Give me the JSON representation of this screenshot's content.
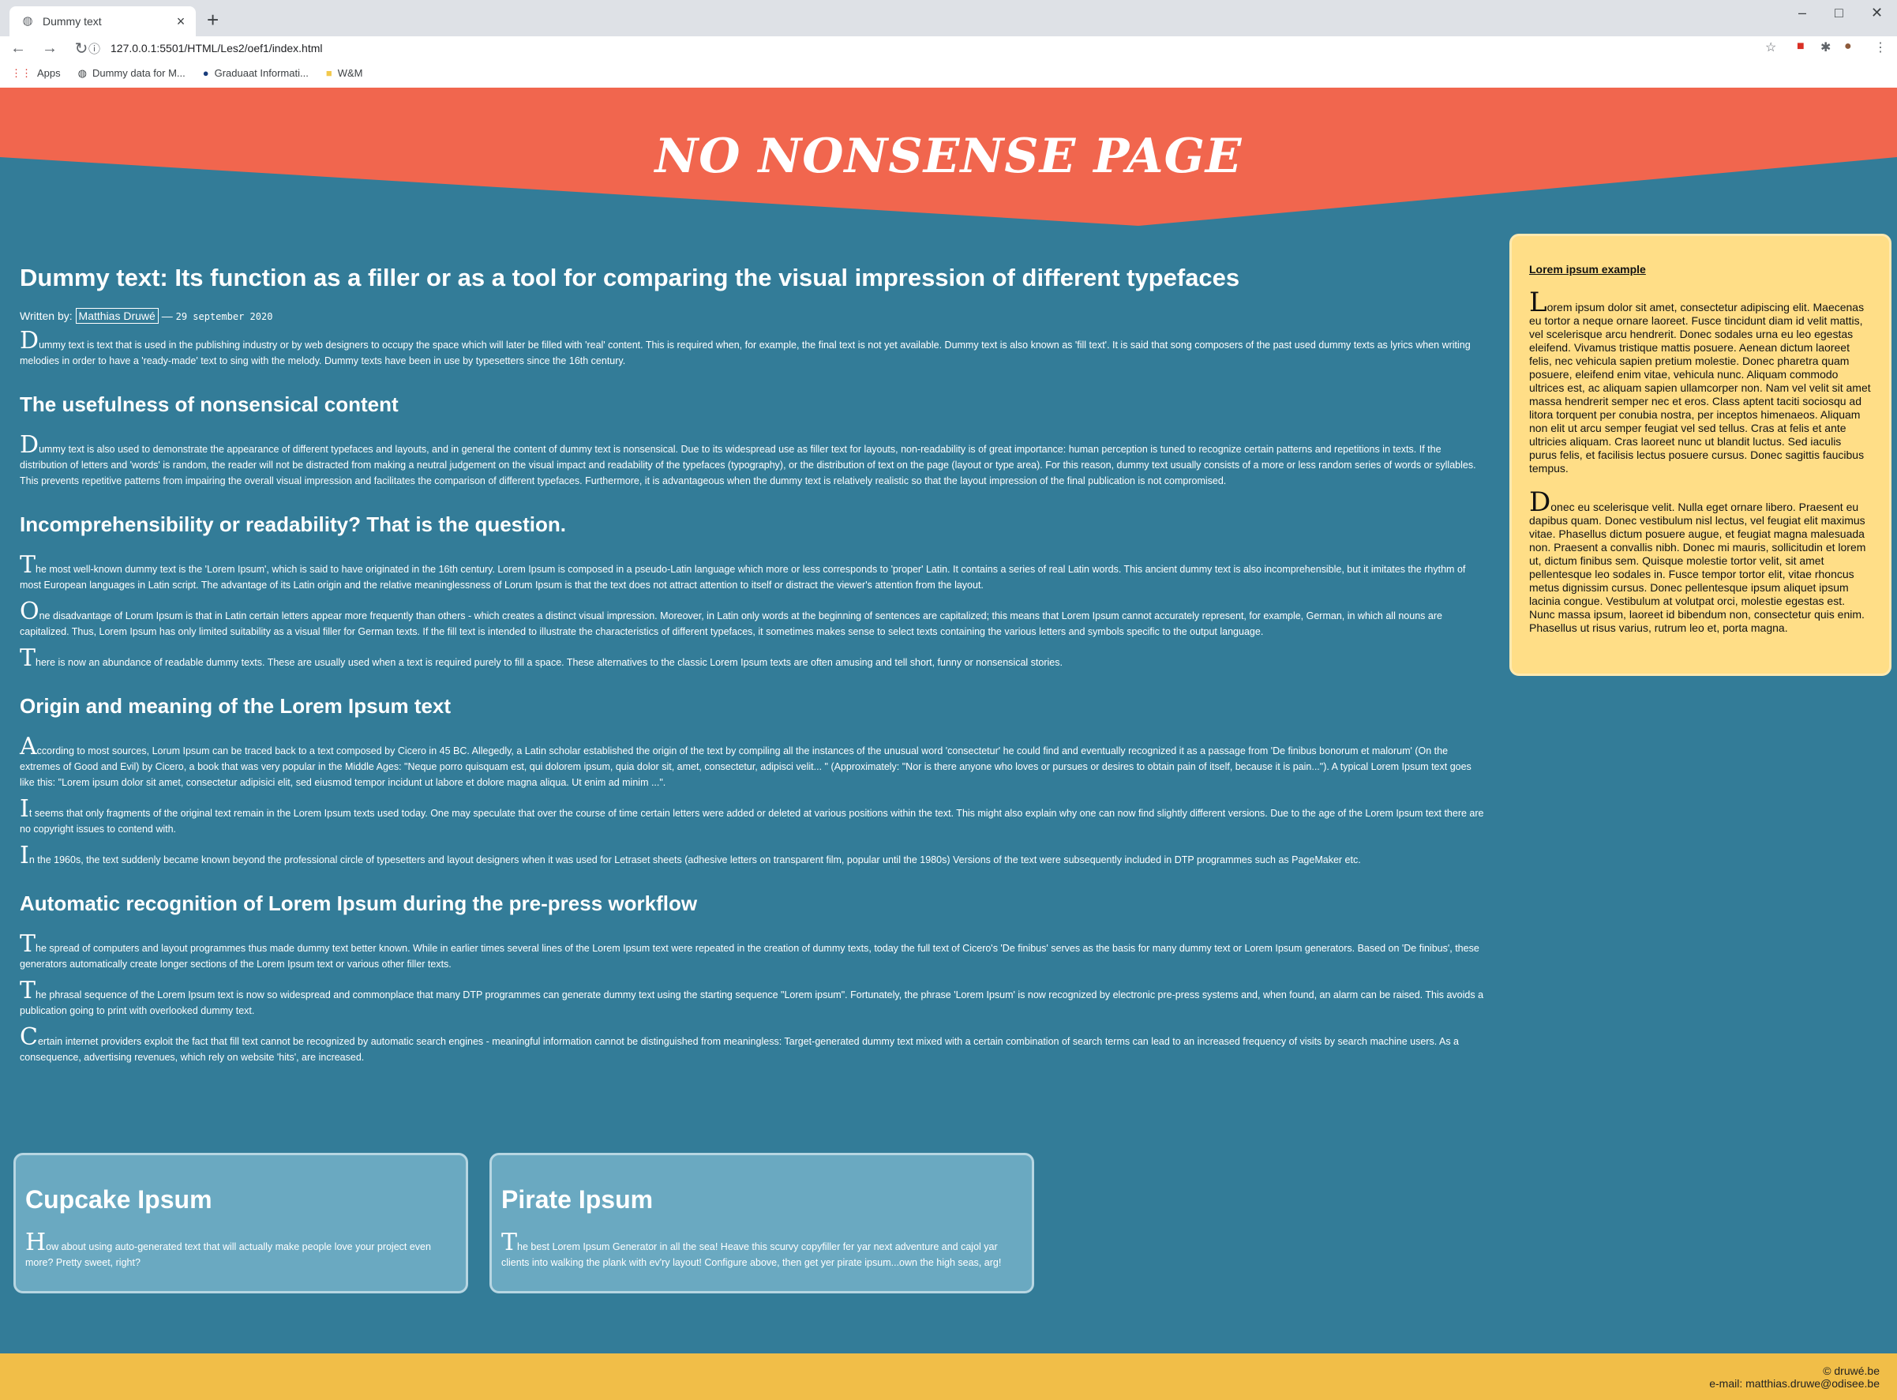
{
  "browser": {
    "tab_title": "Dummy text",
    "url": "127.0.0.1:5501/HTML/Les2/oef1/index.html",
    "bookmarks": [
      "Apps",
      "Dummy data for M...",
      "Graduaat Informati...",
      "W&M"
    ]
  },
  "header": {
    "title": "NO NONSENSE PAGE"
  },
  "article": {
    "title": "Dummy text: Its function as a filler or as a tool for comparing the visual impression of different typefaces",
    "byline_prefix": "Written by:",
    "author": "Matthias Druwé",
    "date_sep": "—",
    "date": "29 september 2020",
    "p1_dc": "D",
    "p1": "ummy text is text that is used in the publishing industry or by web designers to occupy the space which will later be filled with 'real' content. This is required when, for example, the final text is not yet available. Dummy text is also known as 'fill text'. It is said that song composers of the past used dummy texts as lyrics when writing melodies in order to have a 'ready-made' text to sing with the melody. Dummy texts have been in use by typesetters since the 16th century.",
    "h_useful": "The usefulness of nonsensical content",
    "p2_dc": "D",
    "p2": "ummy text is also used to demonstrate the appearance of different typefaces and layouts, and in general the content of dummy text is nonsensical. Due to its widespread use as filler text for layouts, non-readability is of great importance: human perception is tuned to recognize certain patterns and repetitions in texts. If the distribution of letters and 'words' is random, the reader will not be distracted from making a neutral judgement on the visual impact and readability of the typefaces (typography), or the distribution of text on the page (layout or type area). For this reason, dummy text usually consists of a more or less random series of words or syllables. This prevents repetitive patterns from impairing the overall visual impression and facilitates the comparison of different typefaces. Furthermore, it is advantageous when the dummy text is relatively realistic so that the layout impression of the final publication is not compromised.",
    "h_incomp": "Incomprehensibility or readability? That is the question.",
    "p3_dc": "T",
    "p3": "he most well-known dummy text is the 'Lorem Ipsum', which is said to have originated in the 16th century. Lorem Ipsum is composed in a pseudo-Latin language which more or less corresponds to 'proper' Latin. It contains a series of real Latin words. This ancient dummy text is also incomprehensible, but it imitates the rhythm of most European languages in Latin script. The advantage of its Latin origin and the relative meaninglessness of Lorum Ipsum is that the text does not attract attention to itself or distract the viewer's attention from the layout.",
    "p4_dc": "O",
    "p4": "ne disadvantage of Lorum Ipsum is that in Latin certain letters appear more frequently than others - which creates a distinct visual impression. Moreover, in Latin only words at the beginning of sentences are capitalized; this means that Lorem Ipsum cannot accurately represent, for example, German, in which all nouns are capitalized. Thus, Lorem Ipsum has only limited suitability as a visual filler for German texts. If the fill text is intended to illustrate the characteristics of different typefaces, it sometimes makes sense to select texts containing the various letters and symbols specific to the output language.",
    "p5_dc": "T",
    "p5": "here is now an abundance of readable dummy texts. These are usually used when a text is required purely to fill a space. These alternatives to the classic Lorem Ipsum texts are often amusing and tell short, funny or nonsensical stories.",
    "h_origin": "Origin and meaning of the Lorem Ipsum text",
    "p6_dc": "A",
    "p6": "ccording to most sources, Lorum Ipsum can be traced back to a text composed by Cicero in 45 BC. Allegedly, a Latin scholar established the origin of the text by compiling all the instances of the unusual word 'consectetur' he could find and eventually recognized it as a passage from 'De finibus bonorum et malorum' (On the extremes of Good and Evil) by Cicero, a book that was very popular in the Middle Ages: \"Neque porro quisquam est, qui dolorem ipsum, quia dolor sit, amet, consectetur, adipisci velit... \" (Approximately: \"Nor is there anyone who loves or pursues or desires to obtain pain of itself, because it is pain...\"). A typical Lorem Ipsum text goes like this: \"Lorem ipsum dolor sit amet, consectetur adipisici elit, sed eiusmod tempor incidunt ut labore et dolore magna aliqua. Ut enim ad minim ...\".",
    "p7_dc": "I",
    "p7": "t seems that only fragments of the original text remain in the Lorem Ipsum texts used today. One may speculate that over the course of time certain letters were added or deleted at various positions within the text. This might also explain why one can now find slightly different versions. Due to the age of the Lorem Ipsum text there are no copyright issues to contend with.",
    "p8_dc": "I",
    "p8": "n the 1960s, the text suddenly became known beyond the professional circle of typesetters and layout designers when it was used for Letraset sheets (adhesive letters on transparent film, popular until the 1980s) Versions of the text were subsequently included in DTP programmes such as PageMaker etc.",
    "h_auto": "Automatic recognition of Lorem Ipsum during the pre-press workflow",
    "p9_dc": "T",
    "p9": "he spread of computers and layout programmes thus made dummy text better known. While in earlier times several lines of the Lorem Ipsum text were repeated in the creation of dummy texts, today the full text of Cicero's 'De finibus' serves as the basis for many dummy text or Lorem Ipsum generators. Based on 'De finibus', these generators automatically create longer sections of the Lorem Ipsum text or various other filler texts.",
    "p10_dc": "T",
    "p10": "he phrasal sequence of the Lorem Ipsum text is now so widespread and commonplace that many DTP programmes can generate dummy text using the starting sequence \"Lorem ipsum\". Fortunately, the phrase 'Lorem Ipsum' is now recognized by electronic pre-press systems and, when found, an alarm can be raised. This avoids a publication going to print with overlooked dummy text.",
    "p11_dc": "C",
    "p11": "ertain internet providers exploit the fact that fill text cannot be recognized by automatic search engines - meaningful information cannot be distinguished from meaningless: Target-generated dummy text mixed with a certain combination of search terms can lead to an increased frequency of visits by search machine users. As a consequence, advertising revenues, which rely on website 'hits', are increased."
  },
  "aside": {
    "title": "Lorem ipsum example",
    "p1_dc": "L",
    "p1": "orem ipsum dolor sit amet, consectetur adipiscing elit. Maecenas eu tortor a neque ornare laoreet. Fusce tincidunt diam id velit mattis, vel scelerisque arcu hendrerit. Donec sodales urna eu leo egestas eleifend. Vivamus tristique mattis posuere. Aenean dictum laoreet felis, nec vehicula sapien pretium molestie. Donec pharetra quam posuere, eleifend enim vitae, vehicula nunc. Aliquam commodo ultrices est, ac aliquam sapien ullamcorper non. Nam vel velit sit amet massa hendrerit semper nec et eros. Class aptent taciti sociosqu ad litora torquent per conubia nostra, per inceptos himenaeos. Aliquam non elit ut arcu semper feugiat vel sed tellus. Cras at felis et ante ultricies aliquam. Cras laoreet nunc ut blandit luctus. Sed iaculis purus felis, et facilisis lectus posuere cursus. Donec sagittis faucibus tempus.",
    "p2_dc": "D",
    "p2": "onec eu scelerisque velit. Nulla eget ornare libero. Praesent eu dapibus quam. Donec vestibulum nisl lectus, vel feugiat elit maximus vitae. Phasellus dictum posuere augue, et feugiat magna malesuada non. Praesent a convallis nibh. Donec mi mauris, sollicitudin et lorem ut, dictum finibus sem. Quisque molestie tortor velit, sit amet pellentesque leo sodales in. Fusce tempor tortor elit, vitae rhoncus metus dignissim cursus. Donec pellentesque ipsum aliquet ipsum lacinia congue. Vestibulum at volutpat orci, molestie egestas est. Nunc massa ipsum, laoreet id bibendum non, consectetur quis enim. Phasellus ut risus varius, rutrum leo et, porta magna."
  },
  "cards": [
    {
      "title": "Cupcake Ipsum",
      "dc": "H",
      "text": "ow about using auto-generated text that will actually make people love your project even more? Pretty sweet, right?"
    },
    {
      "title": "Pirate Ipsum",
      "dc": "T",
      "text": "he best Lorem Ipsum Generator in all the sea! Heave this scurvy copyfiller fer yar next adventure and cajol yar clients into walking the plank with ev'ry layout! Configure above, then get yer pirate ipsum...own the high seas, arg!"
    }
  ],
  "footer": {
    "copyright": "© druwé.be",
    "email": "e-mail: matthias.druwe@odisee.be"
  },
  "colors": {
    "header": "#f1664e",
    "body": "#337c98",
    "aside": "#ffde87",
    "card": "#6aa9c1",
    "footer": "#f1be48"
  }
}
